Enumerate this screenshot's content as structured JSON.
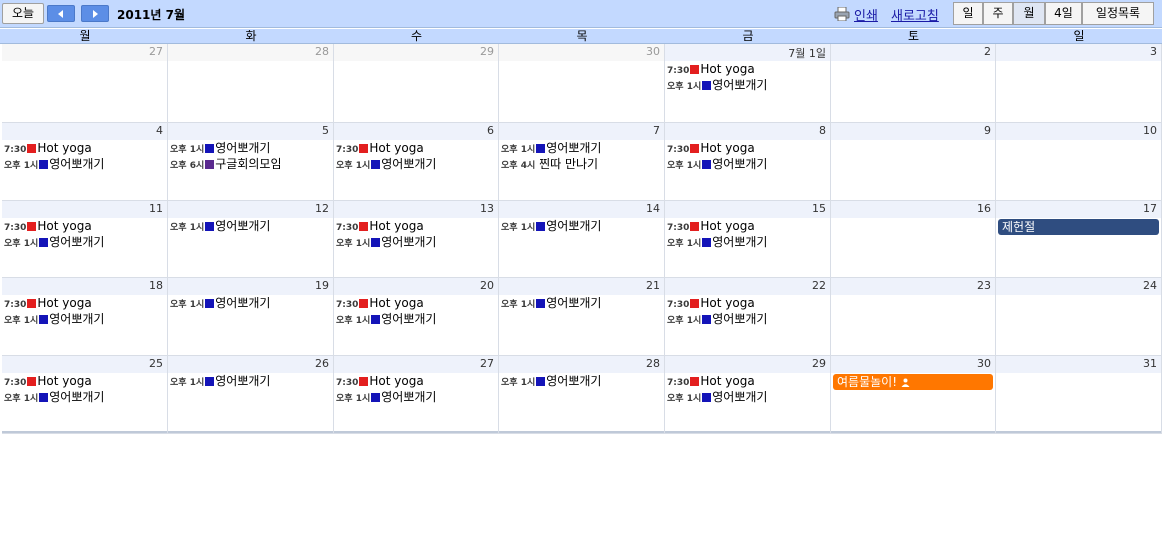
{
  "toolbar": {
    "today_label": "오늘",
    "date_range": "2011년 7월",
    "print_label": "인쇄",
    "refresh_label": "새로고침",
    "views": {
      "day": "일",
      "week": "주",
      "month": "월",
      "four_day": "4일",
      "agenda": "일정목록"
    },
    "active_view": "month"
  },
  "weekdays": [
    "월",
    "화",
    "수",
    "목",
    "금",
    "토",
    "일"
  ],
  "colors": {
    "toolbar_bg": "#c3d9ff",
    "nav_button": "#5c8ee6",
    "red": "#e31f1f",
    "blue": "#1414b8",
    "purple": "#5b2a8f",
    "holiday": "#2f4d80",
    "orange": "#ff7700"
  },
  "weeks": [
    {
      "days": [
        {
          "num": "27",
          "other": true,
          "events": []
        },
        {
          "num": "28",
          "other": true,
          "events": []
        },
        {
          "num": "29",
          "other": true,
          "events": []
        },
        {
          "num": "30",
          "other": true,
          "events": []
        },
        {
          "num": "7월 1일",
          "events": [
            {
              "time": "7:30",
              "color": "red",
              "title": "Hot yoga"
            },
            {
              "time": "오후 1시",
              "color": "blue",
              "title": "영어뽀개기"
            }
          ]
        },
        {
          "num": "2",
          "events": []
        },
        {
          "num": "3",
          "events": []
        }
      ]
    },
    {
      "days": [
        {
          "num": "4",
          "events": [
            {
              "time": "7:30",
              "color": "red",
              "title": "Hot yoga"
            },
            {
              "time": "오후 1시",
              "color": "blue",
              "title": "영어뽀개기"
            }
          ]
        },
        {
          "num": "5",
          "events": [
            {
              "time": "오후 1시",
              "color": "blue",
              "title": "영어뽀개기"
            },
            {
              "time": "오후 6시",
              "color": "purple",
              "title": "구글회의모임"
            }
          ]
        },
        {
          "num": "6",
          "events": [
            {
              "time": "7:30",
              "color": "red",
              "title": "Hot yoga"
            },
            {
              "time": "오후 1시",
              "color": "blue",
              "title": "영어뽀개기"
            }
          ]
        },
        {
          "num": "7",
          "events": [
            {
              "time": "오후 1시",
              "color": "blue",
              "title": "영어뽀개기"
            },
            {
              "time": "오후 4시",
              "color": "none",
              "title": "찐따 만나기"
            }
          ]
        },
        {
          "num": "8",
          "events": [
            {
              "time": "7:30",
              "color": "red",
              "title": "Hot yoga"
            },
            {
              "time": "오후 1시",
              "color": "blue",
              "title": "영어뽀개기"
            }
          ]
        },
        {
          "num": "9",
          "events": []
        },
        {
          "num": "10",
          "events": []
        }
      ]
    },
    {
      "days": [
        {
          "num": "11",
          "events": [
            {
              "time": "7:30",
              "color": "red",
              "title": "Hot yoga"
            },
            {
              "time": "오후 1시",
              "color": "blue",
              "title": "영어뽀개기"
            }
          ]
        },
        {
          "num": "12",
          "events": [
            {
              "time": "오후 1시",
              "color": "blue",
              "title": "영어뽀개기"
            }
          ]
        },
        {
          "num": "13",
          "events": [
            {
              "time": "7:30",
              "color": "red",
              "title": "Hot yoga"
            },
            {
              "time": "오후 1시",
              "color": "blue",
              "title": "영어뽀개기"
            }
          ]
        },
        {
          "num": "14",
          "events": [
            {
              "time": "오후 1시",
              "color": "blue",
              "title": "영어뽀개기"
            }
          ]
        },
        {
          "num": "15",
          "events": [
            {
              "time": "7:30",
              "color": "red",
              "title": "Hot yoga"
            },
            {
              "time": "오후 1시",
              "color": "blue",
              "title": "영어뽀개기"
            }
          ]
        },
        {
          "num": "16",
          "events": []
        },
        {
          "num": "17",
          "events": [],
          "allday": {
            "title": "제헌절",
            "color": "holiday"
          }
        }
      ]
    },
    {
      "days": [
        {
          "num": "18",
          "events": [
            {
              "time": "7:30",
              "color": "red",
              "title": "Hot yoga"
            },
            {
              "time": "오후 1시",
              "color": "blue",
              "title": "영어뽀개기"
            }
          ]
        },
        {
          "num": "19",
          "events": [
            {
              "time": "오후 1시",
              "color": "blue",
              "title": "영어뽀개기"
            }
          ]
        },
        {
          "num": "20",
          "events": [
            {
              "time": "7:30",
              "color": "red",
              "title": "Hot yoga"
            },
            {
              "time": "오후 1시",
              "color": "blue",
              "title": "영어뽀개기"
            }
          ]
        },
        {
          "num": "21",
          "events": [
            {
              "time": "오후 1시",
              "color": "blue",
              "title": "영어뽀개기"
            }
          ]
        },
        {
          "num": "22",
          "events": [
            {
              "time": "7:30",
              "color": "red",
              "title": "Hot yoga"
            },
            {
              "time": "오후 1시",
              "color": "blue",
              "title": "영어뽀개기"
            }
          ]
        },
        {
          "num": "23",
          "events": []
        },
        {
          "num": "24",
          "events": []
        }
      ]
    },
    {
      "days": [
        {
          "num": "25",
          "events": [
            {
              "time": "7:30",
              "color": "red",
              "title": "Hot yoga"
            },
            {
              "time": "오후 1시",
              "color": "blue",
              "title": "영어뽀개기"
            }
          ]
        },
        {
          "num": "26",
          "events": [
            {
              "time": "오후 1시",
              "color": "blue",
              "title": "영어뽀개기"
            }
          ]
        },
        {
          "num": "27",
          "events": [
            {
              "time": "7:30",
              "color": "red",
              "title": "Hot yoga"
            },
            {
              "time": "오후 1시",
              "color": "blue",
              "title": "영어뽀개기"
            }
          ]
        },
        {
          "num": "28",
          "events": [
            {
              "time": "오후 1시",
              "color": "blue",
              "title": "영어뽀개기"
            }
          ]
        },
        {
          "num": "29",
          "events": [
            {
              "time": "7:30",
              "color": "red",
              "title": "Hot yoga"
            },
            {
              "time": "오후 1시",
              "color": "blue",
              "title": "영어뽀개기"
            }
          ]
        },
        {
          "num": "30",
          "events": [],
          "allday": {
            "title": "여름물놀이!",
            "color": "orange",
            "icon": "person-icon"
          }
        },
        {
          "num": "31",
          "events": []
        }
      ]
    }
  ]
}
